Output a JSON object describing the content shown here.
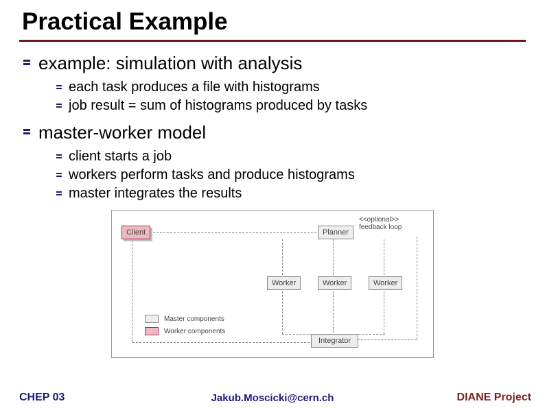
{
  "title": "Practical Example",
  "items": [
    {
      "text": "example: simulation with analysis",
      "children": [
        "each task produces a file with histograms",
        "job result = sum of histograms produced by tasks"
      ]
    },
    {
      "text": "master-worker model",
      "children": [
        "client starts a job",
        "workers perform tasks and produce histograms",
        "master integrates the results"
      ]
    }
  ],
  "diagram": {
    "client": "Client",
    "planner": "Planner",
    "worker": "Worker",
    "integrator": "Integrator",
    "optional_line1": "<<optional>>",
    "optional_line2": "feedback loop",
    "legend_master": "Master components",
    "legend_worker": "Worker components"
  },
  "footer": {
    "left": "CHEP 03",
    "center": "Jakub.Moscicki@cern.ch",
    "right": "DIANE Project"
  }
}
